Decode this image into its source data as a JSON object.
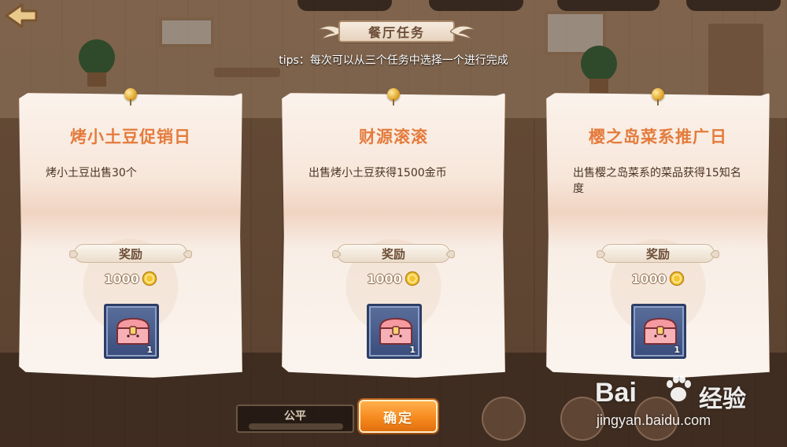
{
  "dialog": {
    "title": "餐厅任务",
    "tips": "tips：每次可以从三个任务中选择一个进行完成"
  },
  "quests": [
    {
      "title": "烤小土豆促销日",
      "description": "烤小土豆出售30个",
      "reward_label": "奖励",
      "coins": "1000",
      "item_count": "1",
      "item_icon": "treasure-chest-icon"
    },
    {
      "title": "财源滚滚",
      "description": "出售烤小土豆获得1500金币",
      "reward_label": "奖励",
      "coins": "1000",
      "item_count": "1",
      "item_icon": "treasure-chest-icon"
    },
    {
      "title": "樱之岛菜系推广日",
      "description": "出售樱之岛菜系的菜品获得15知名度",
      "reward_label": "奖励",
      "coins": "1000",
      "item_count": "1",
      "item_icon": "treasure-chest-icon"
    }
  ],
  "bottom": {
    "fairness_label": "公平",
    "confirm_label": "确定"
  },
  "watermark": {
    "logo": "Bai",
    "logo_cn": "经验",
    "url": "jingyan.baidu.com"
  },
  "colors": {
    "quest_title": "#e47b3c",
    "confirm_button": "#f68a1f",
    "chest_slot": "#3a4d7c"
  }
}
